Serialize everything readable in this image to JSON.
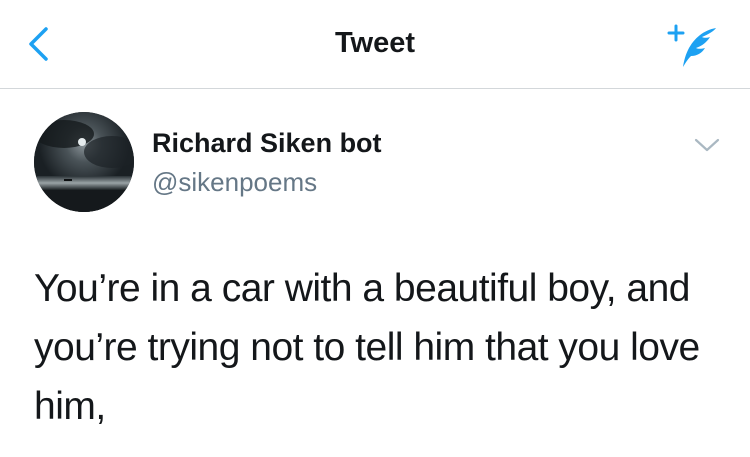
{
  "header": {
    "title": "Tweet",
    "back_icon": "chevron-left-icon",
    "compose_icon": "compose-tweet-icon",
    "accent_color": "#1da1f2"
  },
  "tweet": {
    "author": {
      "name": "Richard Siken bot",
      "handle": "@sikenpoems",
      "avatar": "night-sea-moon-avatar"
    },
    "menu_icon": "chevron-down-icon",
    "text": "You’re in a car with a beautiful boy, and you’re trying not to tell him that you love him,"
  },
  "colors": {
    "text_primary": "#14171a",
    "text_secondary": "#657786",
    "divider": "#d3d7da"
  }
}
